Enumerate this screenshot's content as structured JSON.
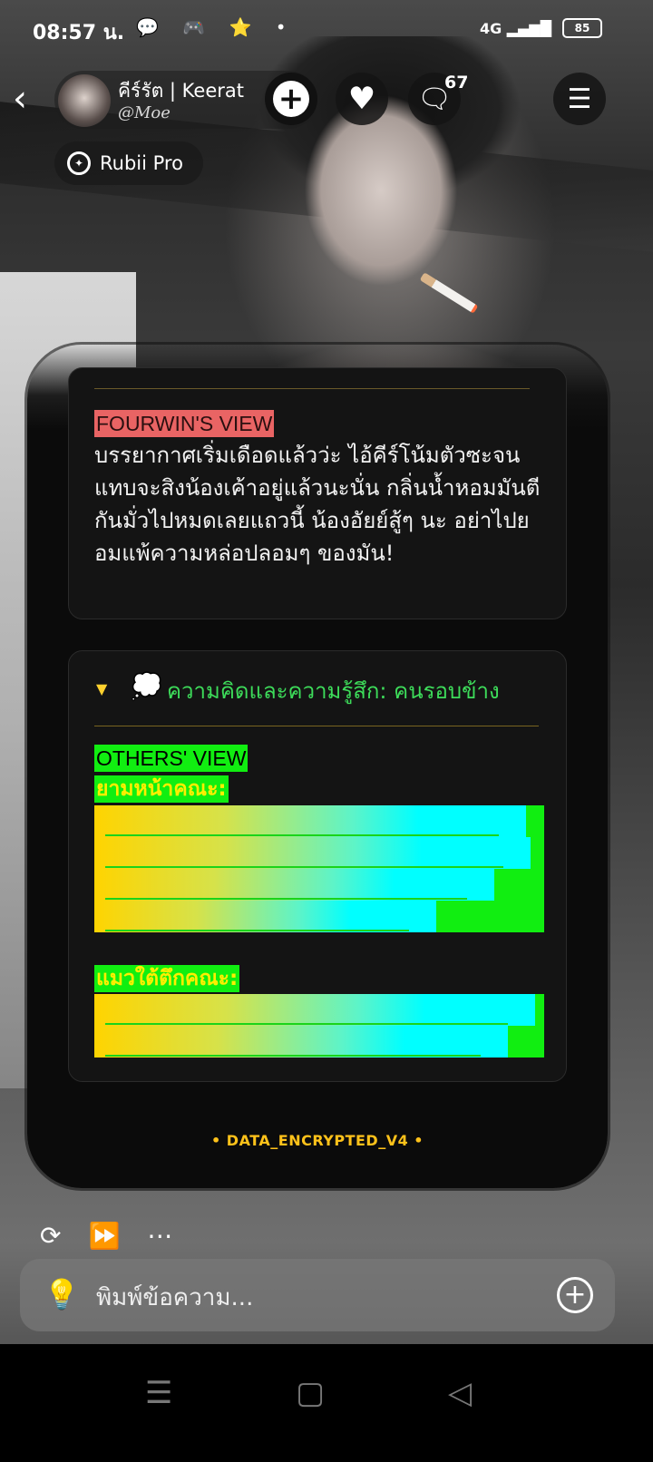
{
  "status_bar": {
    "time": "08:57 น.",
    "notification_icons": "💬 🎮 ⭐ •",
    "network": "4G",
    "battery": "85"
  },
  "header": {
    "character_name": "คีร์รัต | Keerat",
    "creator_handle": "@Moe",
    "comment_count": "67",
    "pro_label": "Rubii Pro"
  },
  "message": {
    "fourwin_view": {
      "title": "FOURWIN'S VIEW",
      "text": "บรรยากาศเริ่มเดือดแล้วว่ะ ไอ้คีร์โน้มตัวซะจนแทบจะสิงน้องเค้าอยู่แล้วนะนั่น กลิ่นน้ำหอมมันตีกันมั่วไปหมดเลยแถวนี้ น้องอัยย์สู้ๆ นะ อย่าไปยอมแพ้ความหล่อปลอมๆ ของมัน!"
    },
    "thoughts_section": {
      "heading": "ความคิดและความรู้สึก: คนรอบข้าง",
      "others_view_title": "OTHERS' VIEW",
      "sub1": "ยามหน้าคณะ:",
      "sub2": "แมวใต้ตึกคณะ:",
      "bars1_fill": [
        0.96,
        0.97,
        0.89,
        0.76
      ],
      "bars2_fill": [
        0.98,
        0.92
      ]
    },
    "footer": "• DATA_ENCRYPTED_V4 •"
  },
  "composer": {
    "placeholder": "พิมพ์ข้อความ..."
  },
  "colors": {
    "highlight_red": "#e96464",
    "highlight_green": "#11ee11",
    "heading_green": "#3ddc5a",
    "encrypted_gold": "#ffc21a"
  }
}
